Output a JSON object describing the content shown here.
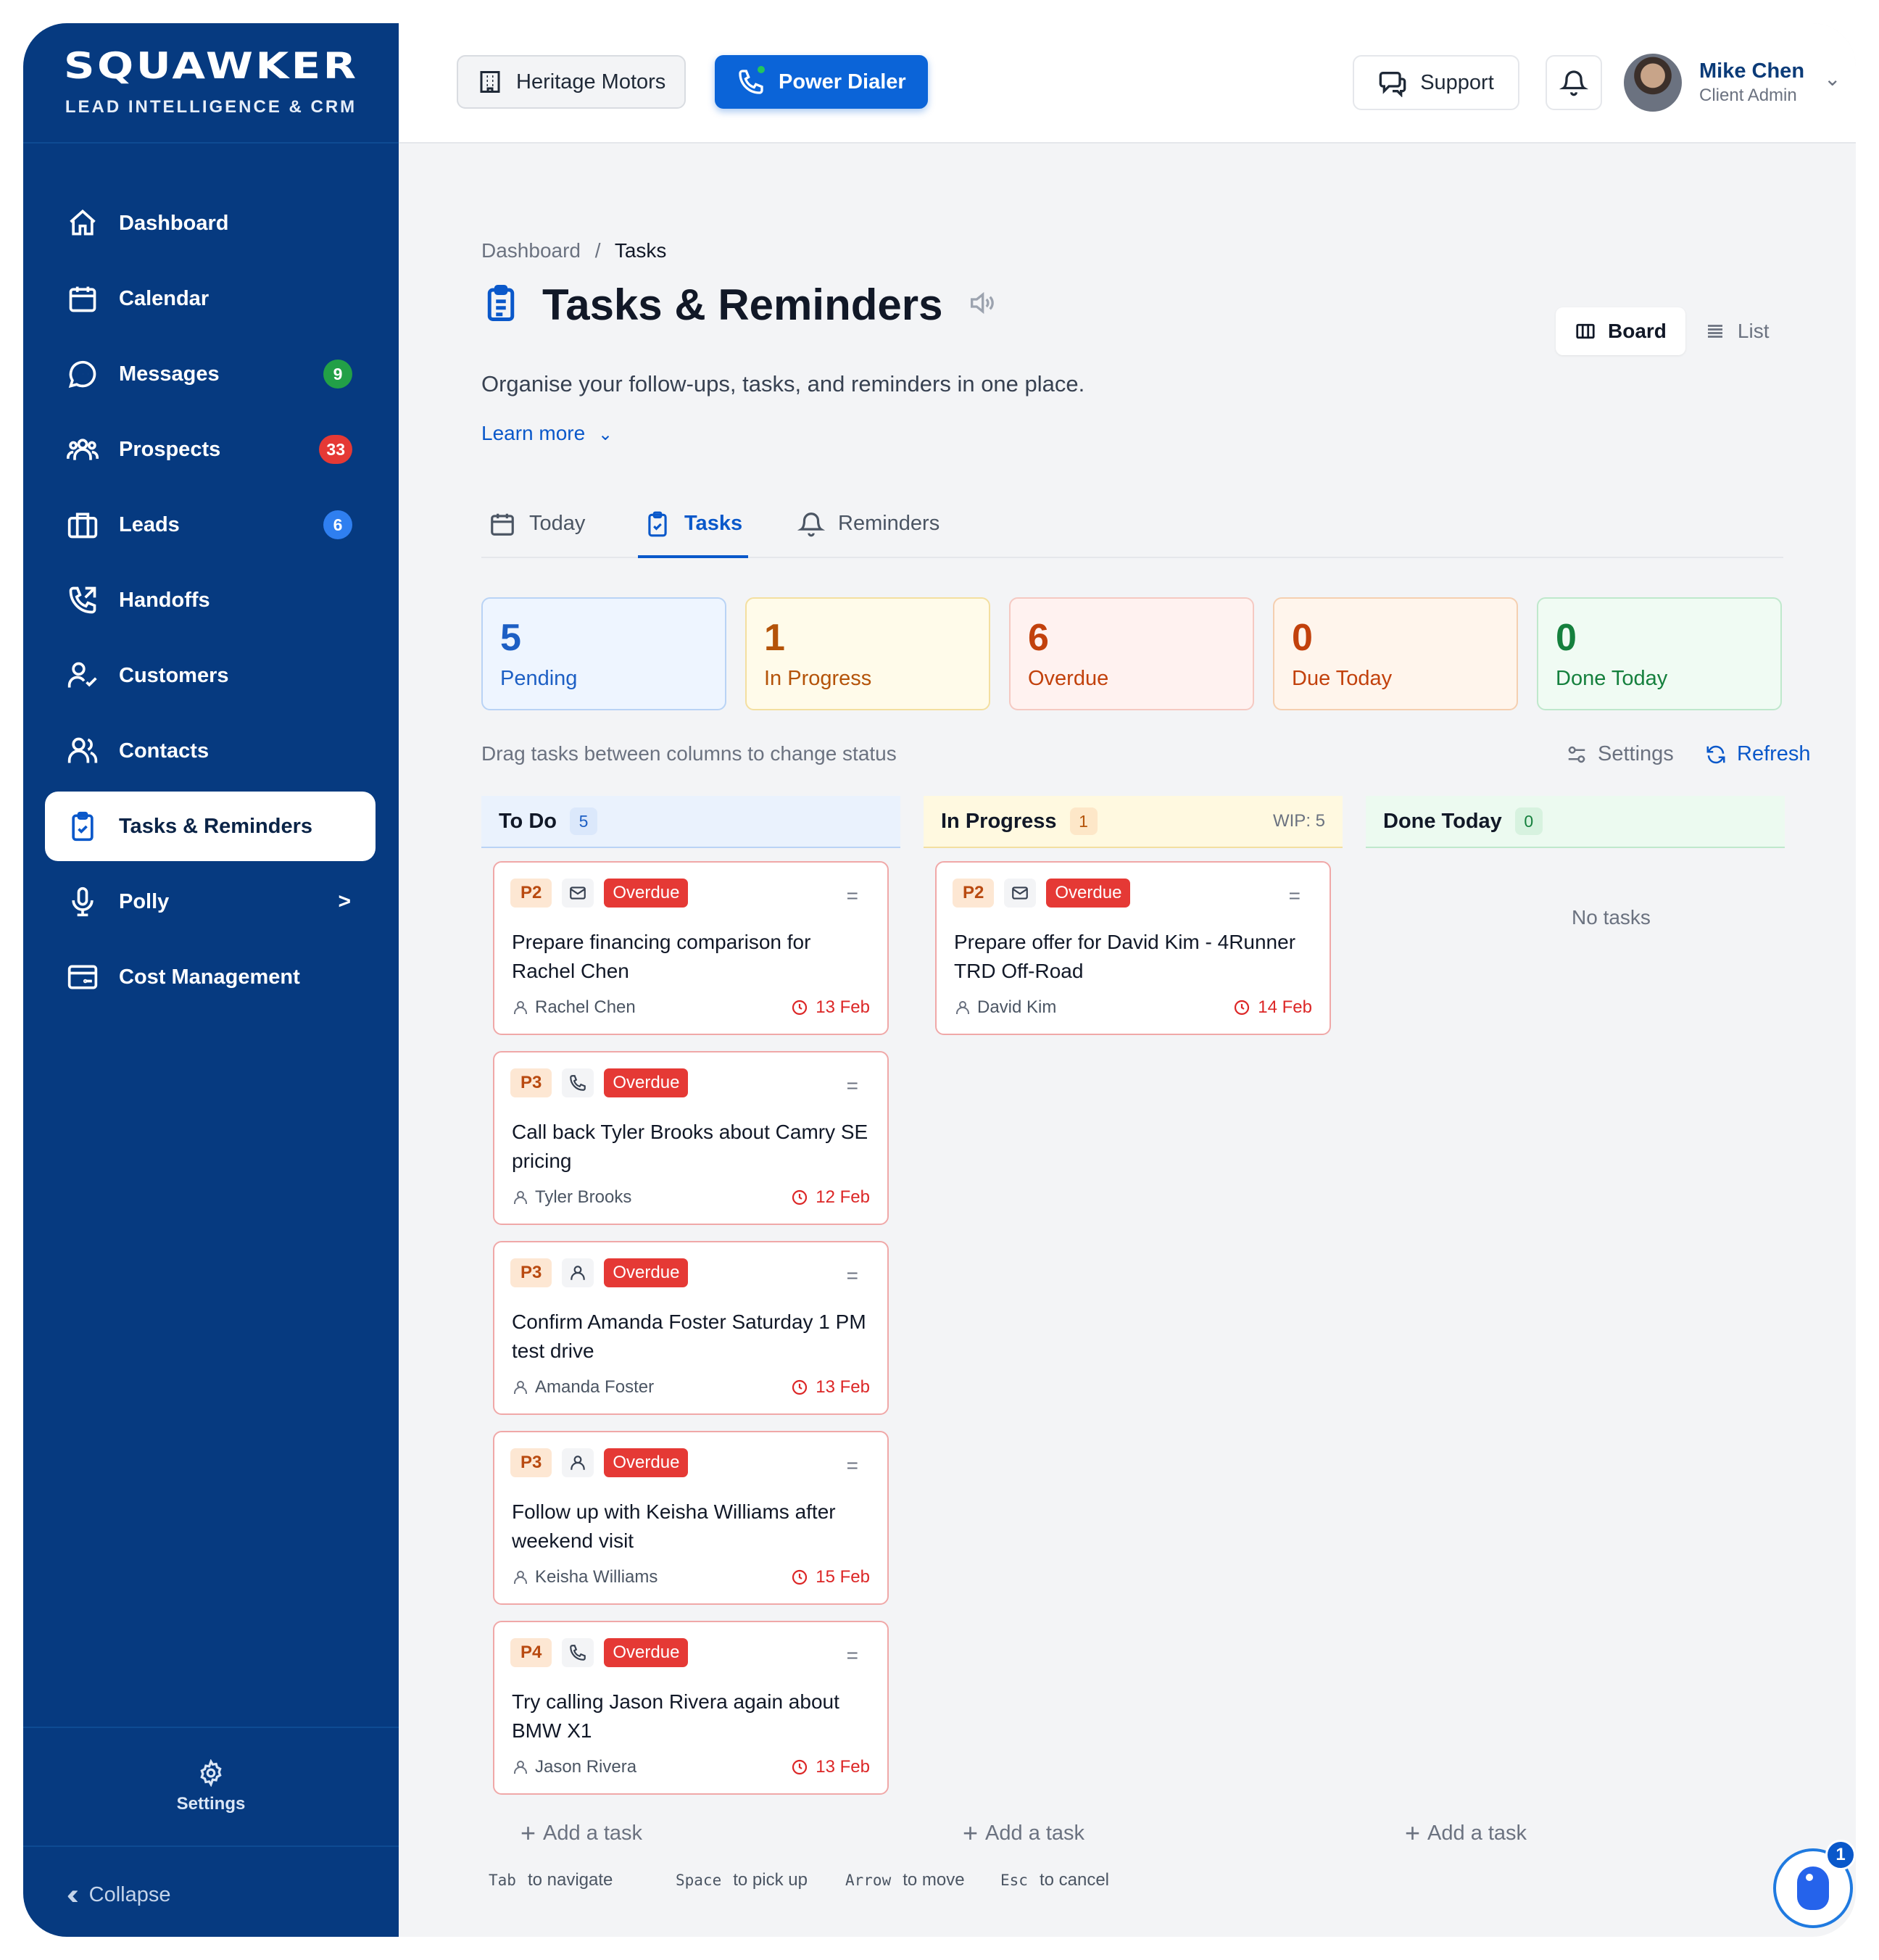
{
  "brand": {
    "name": "SQUAWKER",
    "tagline": "LEAD INTELLIGENCE & CRM"
  },
  "sidebar": {
    "items": [
      {
        "label": "Dashboard",
        "icon": "home-icon"
      },
      {
        "label": "Calendar",
        "icon": "calendar-icon"
      },
      {
        "label": "Messages",
        "icon": "message-icon",
        "badge": "9",
        "badge_color": "#22a047"
      },
      {
        "label": "Prospects",
        "icon": "users-group-icon",
        "badge": "33",
        "badge_color": "#e53935"
      },
      {
        "label": "Leads",
        "icon": "briefcase-icon",
        "badge": "6",
        "badge_color": "#2f7ff0"
      },
      {
        "label": "Handoffs",
        "icon": "phone-transfer-icon"
      },
      {
        "label": "Customers",
        "icon": "user-check-icon"
      },
      {
        "label": "Contacts",
        "icon": "contacts-icon"
      },
      {
        "label": "Tasks & Reminders",
        "icon": "clipboard-check-icon",
        "active": true
      },
      {
        "label": "Polly",
        "icon": "microphone-icon",
        "chevron": ">"
      },
      {
        "label": "Cost Management",
        "icon": "wallet-icon"
      }
    ],
    "settings_label": "Settings",
    "collapse_label": "Collapse"
  },
  "header": {
    "dealership": "Heritage Motors",
    "dialer": "Power Dialer",
    "support": "Support",
    "user_name": "Mike Chen",
    "user_role": "Client Admin"
  },
  "breadcrumb": {
    "root": "Dashboard",
    "sep": "/",
    "current": "Tasks"
  },
  "page": {
    "title": "Tasks & Reminders",
    "subtitle": "Organise your follow-ups, tasks, and reminders in one place.",
    "learn_more": "Learn more",
    "view_board": "Board",
    "view_list": "List"
  },
  "tabs": [
    {
      "label": "Today"
    },
    {
      "label": "Tasks",
      "active": true
    },
    {
      "label": "Reminders"
    }
  ],
  "stats": [
    {
      "value": "5",
      "label": "Pending",
      "bg": "#eef5ff",
      "border": "#b9d3f5",
      "color": "#1d5fc4"
    },
    {
      "value": "1",
      "label": "In Progress",
      "bg": "#fffbea",
      "border": "#f3dfa0",
      "color": "#b45309"
    },
    {
      "value": "6",
      "label": "Overdue",
      "bg": "#fff2f0",
      "border": "#f5c9c2",
      "color": "#c2410c"
    },
    {
      "value": "0",
      "label": "Due Today",
      "bg": "#fff5ec",
      "border": "#f5cfb0",
      "color": "#c2410c"
    },
    {
      "value": "0",
      "label": "Done Today",
      "bg": "#f0fbf3",
      "border": "#bfe8cc",
      "color": "#15803d"
    }
  ],
  "board": {
    "hint": "Drag tasks between columns to change status",
    "settings": "Settings",
    "refresh": "Refresh",
    "columns": [
      {
        "title": "To Do",
        "count": "5",
        "wip": ""
      },
      {
        "title": "In Progress",
        "count": "1",
        "wip": "WIP: 5"
      },
      {
        "title": "Done Today",
        "count": "0",
        "wip": ""
      }
    ],
    "empty_label": "No tasks",
    "add_label": "Add a task",
    "overdue_label": "Overdue",
    "todo_cards": [
      {
        "priority": "P2",
        "type": "mail-icon",
        "title": "Prepare financing comparison for Rachel Chen",
        "contact": "Rachel Chen",
        "due": "13 Feb"
      },
      {
        "priority": "P3",
        "type": "phone-icon",
        "title": "Call back Tyler Brooks about Camry SE pricing",
        "contact": "Tyler Brooks",
        "due": "12 Feb"
      },
      {
        "priority": "P3",
        "type": "user-icon",
        "title": "Confirm Amanda Foster Saturday 1 PM test drive",
        "contact": "Amanda Foster",
        "due": "13 Feb"
      },
      {
        "priority": "P3",
        "type": "user-icon",
        "title": "Follow up with Keisha Williams after weekend visit",
        "contact": "Keisha Williams",
        "due": "15 Feb"
      },
      {
        "priority": "P4",
        "type": "phone-icon",
        "title": "Try calling Jason Rivera again about BMW X1",
        "contact": "Jason Rivera",
        "due": "13 Feb"
      }
    ],
    "progress_cards": [
      {
        "priority": "P2",
        "type": "mail-icon",
        "title": "Prepare offer for David Kim - 4Runner TRD Off-Road",
        "contact": "David Kim",
        "due": "14 Feb"
      }
    ]
  },
  "shortcuts": [
    {
      "key": "Tab",
      "desc": "to navigate"
    },
    {
      "key": "Space",
      "desc": "to pick up"
    },
    {
      "key": "Arrow",
      "desc": "to move"
    },
    {
      "key": "Esc",
      "desc": "to cancel"
    }
  ],
  "assistant": {
    "badge": "1"
  }
}
